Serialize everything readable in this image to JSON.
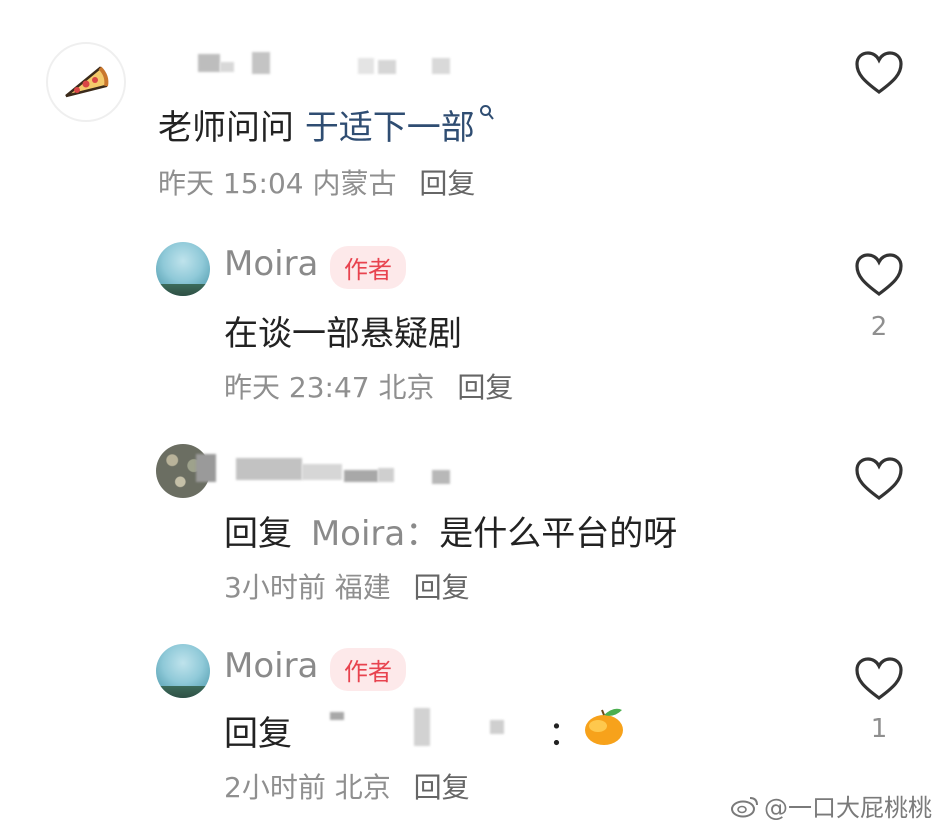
{
  "comments": [
    {
      "username_hidden": true,
      "text_main": "老师问问",
      "text_link": "于适下一部",
      "time": "昨天 15:04",
      "location": "内蒙古",
      "reply": "回复",
      "likes": ""
    },
    {
      "username": "Moira",
      "badge": "作者",
      "text": "在谈一部悬疑剧",
      "time": "昨天 23:47",
      "location": "北京",
      "reply": "回复",
      "likes": "2"
    },
    {
      "username_hidden": true,
      "reply_prefix": "回复",
      "reply_to": "Moira：",
      "text": "是什么平台的呀",
      "time": "3小时前",
      "location": "福建",
      "reply": "回复",
      "likes": ""
    },
    {
      "username": "Moira",
      "badge": "作者",
      "reply_prefix": "回复",
      "reply_colon": "：",
      "time": "2小时前",
      "location": "北京",
      "reply": "回复",
      "likes": "1"
    }
  ],
  "watermark": "@一口大屁桃桃",
  "icons": [
    "pizza-icon",
    "heart-outline-icon",
    "search-icon",
    "mango-emoji-icon",
    "weibo-logo-icon"
  ],
  "colors": {
    "author_badge": "#e8434f",
    "link": "#2f4d72",
    "meta": "#8f8f8f"
  }
}
